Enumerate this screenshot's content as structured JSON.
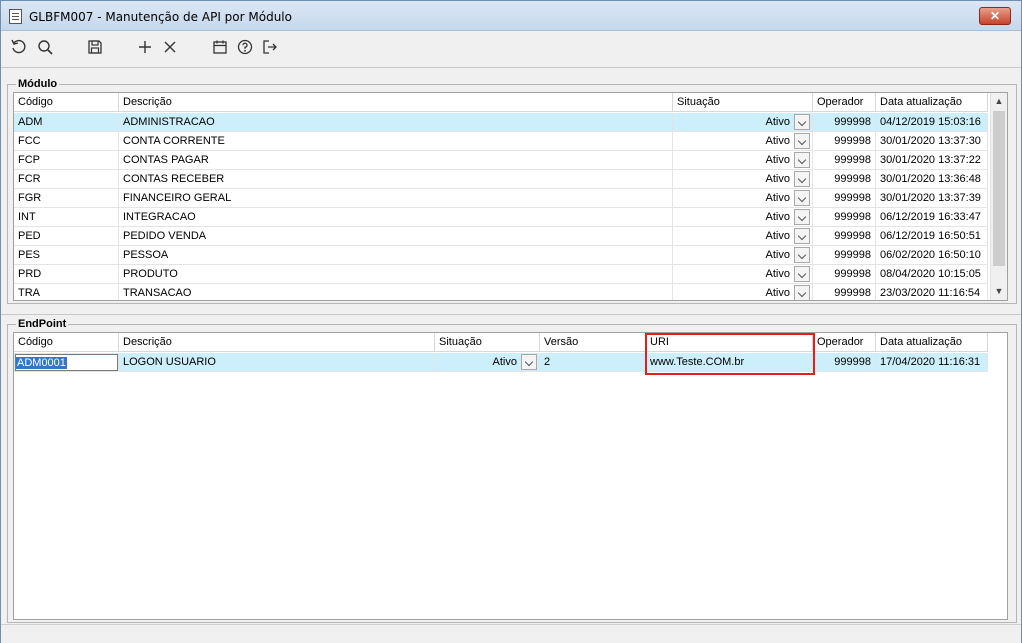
{
  "window": {
    "title": "GLBFM007 - Manutenção de API por Módulo",
    "close_label": "✕"
  },
  "toolbar": {
    "icons": [
      "refresh-icon",
      "search-icon",
      "save-icon",
      "add-icon",
      "delete-icon",
      "calendar-icon",
      "help-icon",
      "exit-icon"
    ]
  },
  "modulo": {
    "group_label": "Módulo",
    "columns": [
      "Código",
      "Descrição",
      "Situação",
      "Operador",
      "Data atualização"
    ],
    "rows": [
      {
        "codigo": "ADM",
        "descricao": "ADMINISTRACAO",
        "situacao": "Ativo",
        "operador": "999998",
        "data": "04/12/2019 15:03:16"
      },
      {
        "codigo": "FCC",
        "descricao": "CONTA CORRENTE",
        "situacao": "Ativo",
        "operador": "999998",
        "data": "30/01/2020 13:37:30"
      },
      {
        "codigo": "FCP",
        "descricao": "CONTAS PAGAR",
        "situacao": "Ativo",
        "operador": "999998",
        "data": "30/01/2020 13:37:22"
      },
      {
        "codigo": "FCR",
        "descricao": "CONTAS RECEBER",
        "situacao": "Ativo",
        "operador": "999998",
        "data": "30/01/2020 13:36:48"
      },
      {
        "codigo": "FGR",
        "descricao": "FINANCEIRO GERAL",
        "situacao": "Ativo",
        "operador": "999998",
        "data": "30/01/2020 13:37:39"
      },
      {
        "codigo": "INT",
        "descricao": "INTEGRACAO",
        "situacao": "Ativo",
        "operador": "999998",
        "data": "06/12/2019 16:33:47"
      },
      {
        "codigo": "PED",
        "descricao": "PEDIDO VENDA",
        "situacao": "Ativo",
        "operador": "999998",
        "data": "06/12/2019 16:50:51"
      },
      {
        "codigo": "PES",
        "descricao": "PESSOA",
        "situacao": "Ativo",
        "operador": "999998",
        "data": "06/02/2020 16:50:10"
      },
      {
        "codigo": "PRD",
        "descricao": "PRODUTO",
        "situacao": "Ativo",
        "operador": "999998",
        "data": "08/04/2020 10:15:05"
      },
      {
        "codigo": "TRA",
        "descricao": "TRANSACAO",
        "situacao": "Ativo",
        "operador": "999998",
        "data": "23/03/2020 11:16:54"
      }
    ],
    "scroll_up": "▲",
    "scroll_down": "▼"
  },
  "endpoint": {
    "group_label": "EndPoint",
    "columns": [
      "Código",
      "Descrição",
      "Situação",
      "Versão",
      "URI",
      "Operador",
      "Data atualização"
    ],
    "rows": [
      {
        "codigo": "ADM0001",
        "descricao": "LOGON USUARIO",
        "situacao": "Ativo",
        "versao": "2",
        "uri": "www.Teste.COM.br",
        "operador": "999998",
        "data": "17/04/2020 11:16:31"
      }
    ]
  }
}
